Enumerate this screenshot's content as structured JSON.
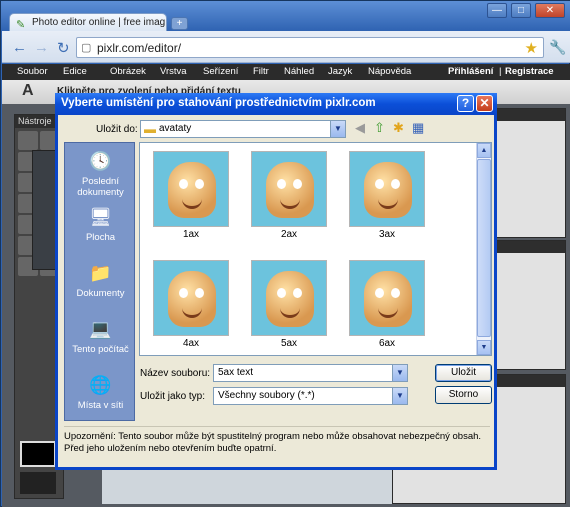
{
  "browser": {
    "tab_title": "Photo editor online | free imag",
    "new_tab_symbol": "+",
    "window_controls": [
      "—",
      "□",
      "✕"
    ],
    "url": "pixlr.com/editor/",
    "back_icon": "←",
    "forward_icon": "→",
    "reload_icon": "↻",
    "star_icon": "★",
    "wrench_icon": "🔧"
  },
  "app": {
    "menu": [
      "Soubor",
      "Edice",
      "Obrázek",
      "Vrstva",
      "Seřízení",
      "Filtr",
      "Náhled",
      "Jazyk",
      "Nápověda"
    ],
    "account": [
      "Přihlášení",
      "|",
      "Registrace"
    ],
    "hint_icon": "A",
    "hint_text": "Klikněte pro zvolení nebo přidání textu",
    "tools_title": "Nástroje"
  },
  "dialog": {
    "title": "Vyberte umístění pro stahování prostřednictvím pixlr.com",
    "help_symbol": "?",
    "close_symbol": "✕",
    "look_in_label": "Uložit do:",
    "look_in_value": "avataty",
    "places": [
      {
        "label": "Poslední dokumenty",
        "icon": "recent-documents-icon",
        "glyph": "🕓"
      },
      {
        "label": "Plocha",
        "icon": "desktop-icon",
        "glyph": "🖥"
      },
      {
        "label": "Dokumenty",
        "icon": "documents-folder-icon",
        "glyph": "📁"
      },
      {
        "label": "Tento počítač",
        "icon": "my-computer-icon",
        "glyph": "💻"
      },
      {
        "label": "Místa v síti",
        "icon": "network-places-icon",
        "glyph": "🌐"
      }
    ],
    "files": [
      "1ax",
      "2ax",
      "3ax",
      "4ax",
      "5ax",
      "6ax"
    ],
    "filename_label": "Název souboru:",
    "filename_value": "5ax text",
    "filetype_label": "Uložit jako typ:",
    "filetype_value": "Všechny soubory (*.*)",
    "save_button": "Uložit",
    "cancel_button": "Storno",
    "warning": "Upozornění: Tento soubor může být spustitelný program nebo může obsahovat nebezpečný obsah. Před jeho uložením nebo otevřením buďte opatrní."
  }
}
